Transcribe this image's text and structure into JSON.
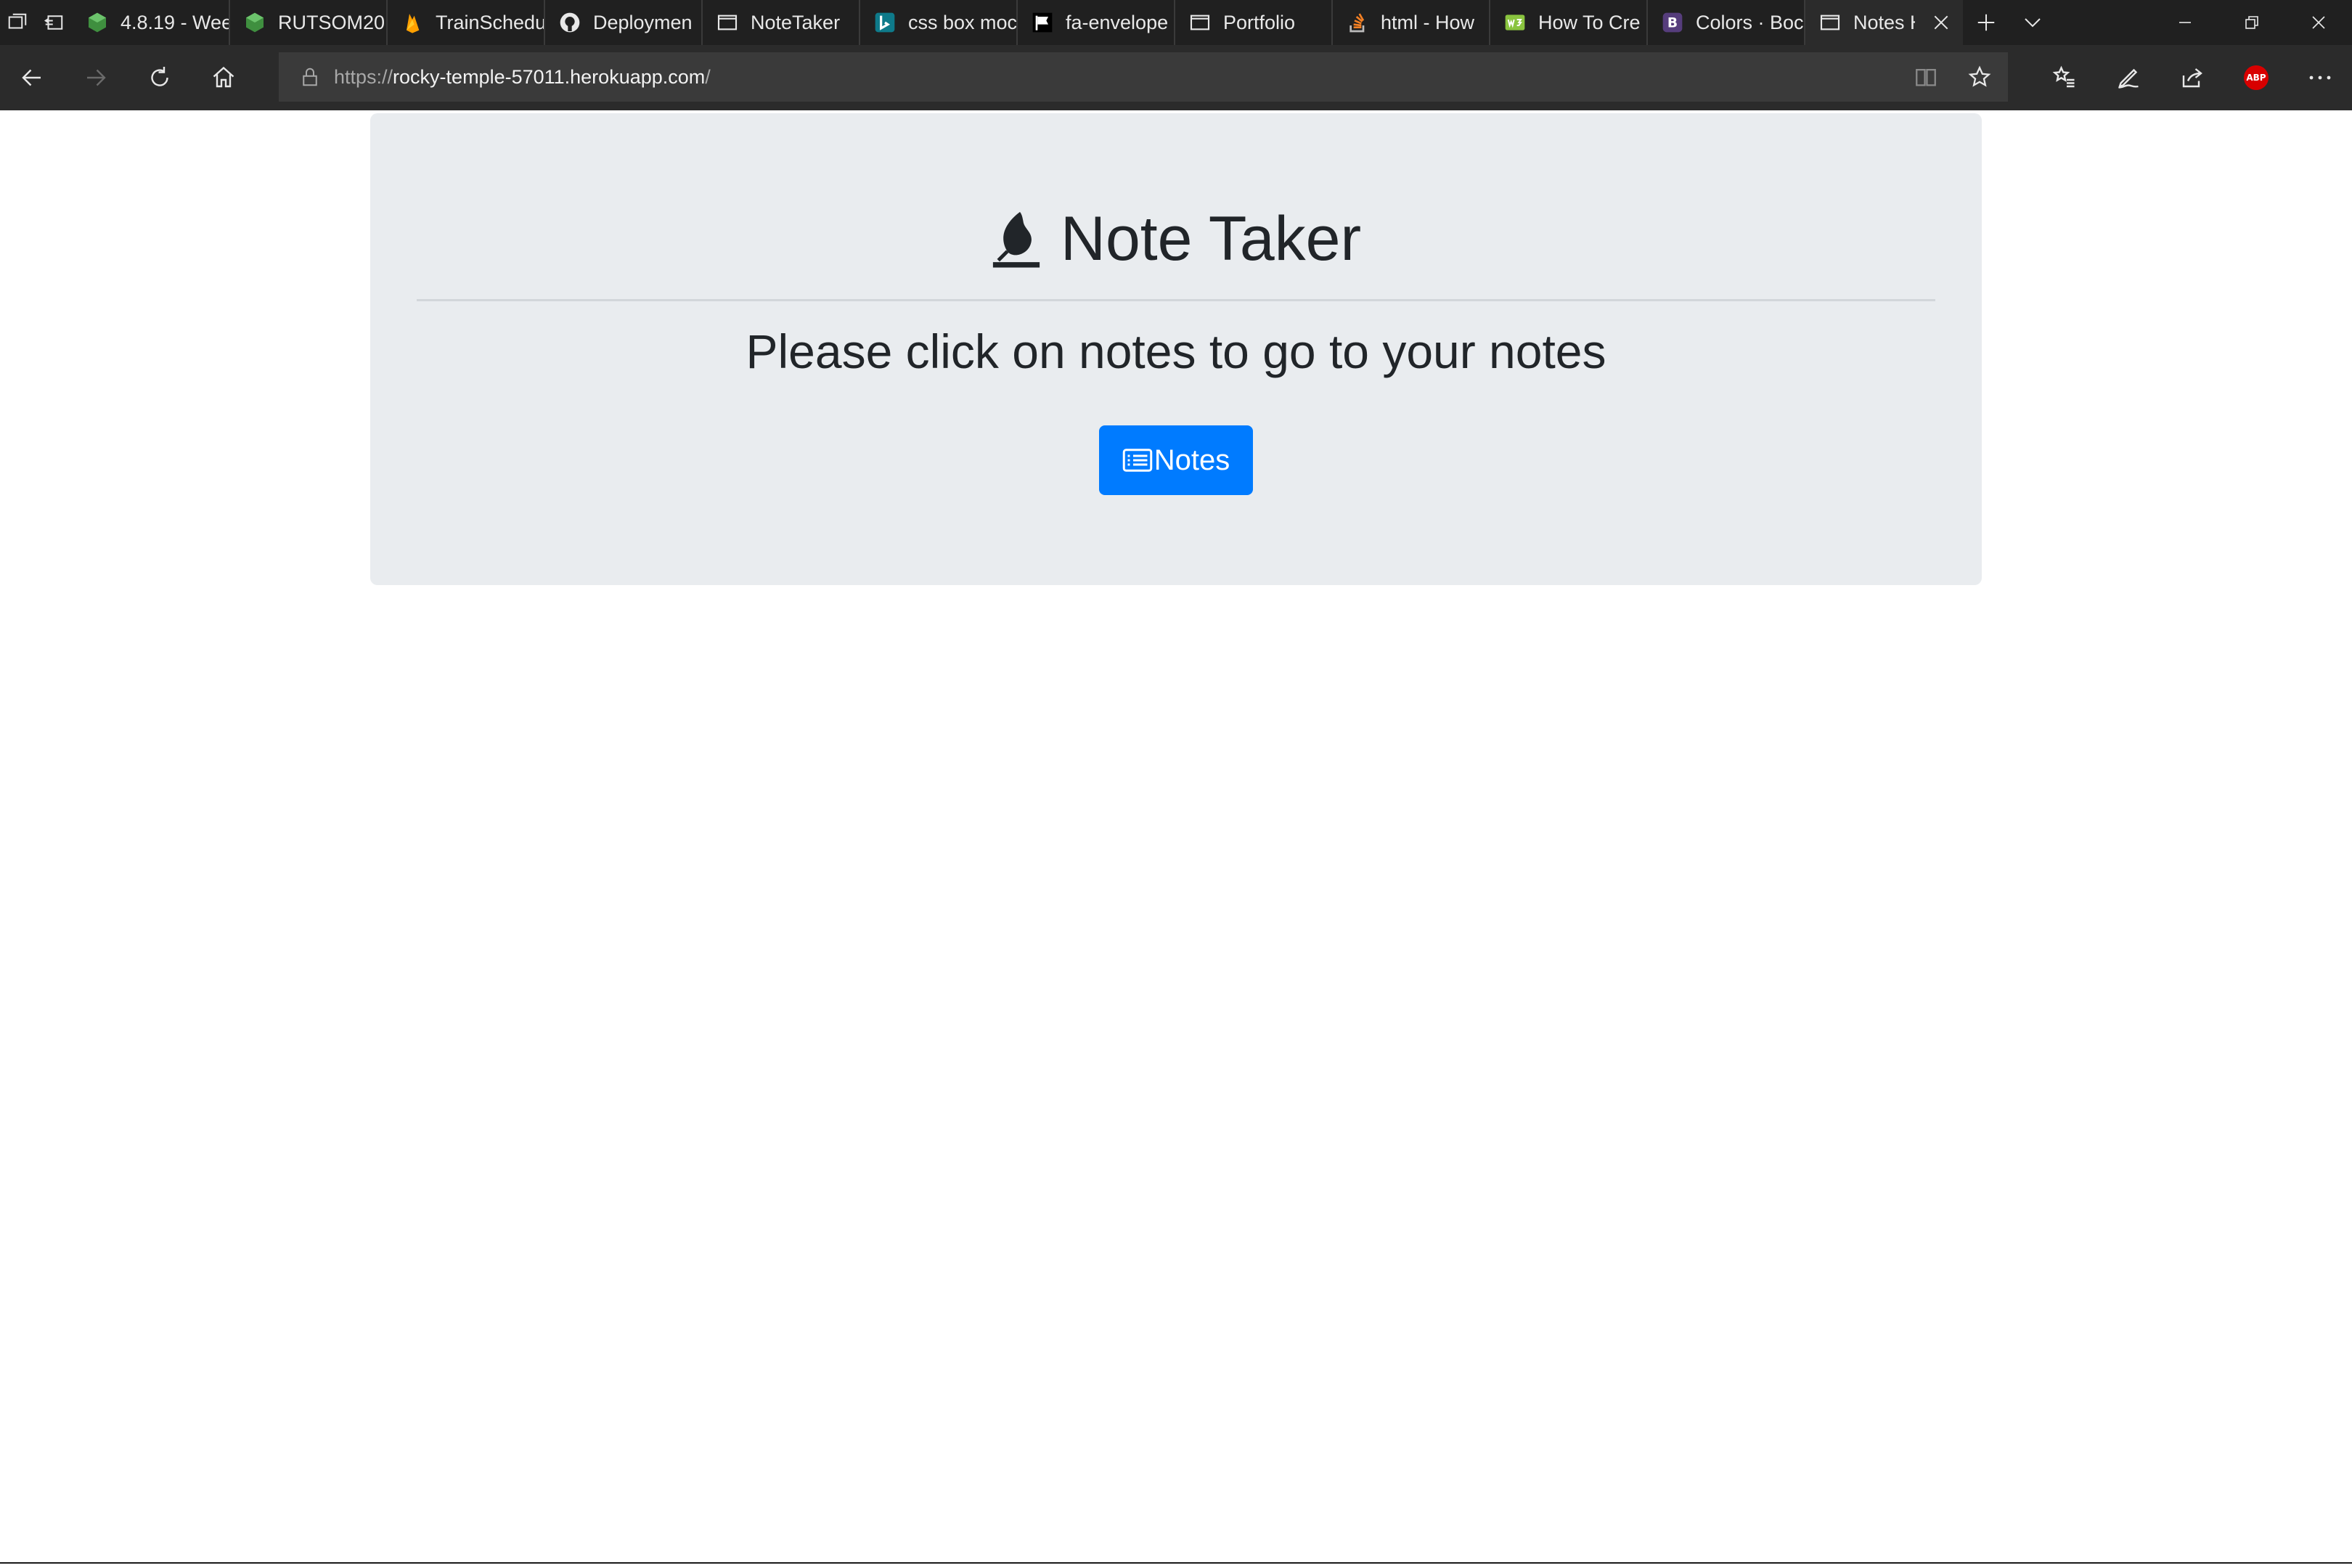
{
  "browser": {
    "tabs": [
      {
        "title": "4.8.19 - Wee",
        "icon": "green-cube-icon",
        "active": false
      },
      {
        "title": "RUTSOM20",
        "icon": "green-cube-icon",
        "active": false
      },
      {
        "title": "TrainSchedu",
        "icon": "firebase-icon",
        "active": false
      },
      {
        "title": "Deploymen",
        "icon": "github-icon",
        "active": false
      },
      {
        "title": "NoteTaker",
        "icon": "page-icon",
        "active": false
      },
      {
        "title": "css box moc",
        "icon": "bing-icon",
        "active": false
      },
      {
        "title": "fa-envelope",
        "icon": "flag-icon",
        "active": false
      },
      {
        "title": "Portfolio",
        "icon": "page-icon",
        "active": false
      },
      {
        "title": "html - How",
        "icon": "stackoverflow-icon",
        "active": false
      },
      {
        "title": "How To Cre",
        "icon": "w3schools-icon",
        "active": false
      },
      {
        "title": "Colors · Boc",
        "icon": "bootstrap-icon",
        "active": false
      },
      {
        "title": "Notes H",
        "icon": "page-icon",
        "active": true
      }
    ],
    "url": {
      "protocol": "https://",
      "host": "rocky-temple-57011.herokuapp.com",
      "path": "/"
    },
    "abp_label": "ABP"
  },
  "page": {
    "title": "Note Taker",
    "subtitle": "Please click on notes to go to your notes",
    "notes_button_label": "Notes",
    "button_color": "#007bff",
    "jumbotron_color": "#e9ecef"
  }
}
